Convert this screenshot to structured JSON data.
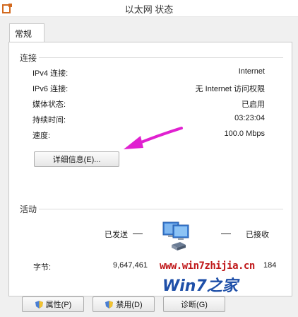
{
  "window": {
    "title": "以太网 状态"
  },
  "tabs": [
    {
      "label": "常规"
    }
  ],
  "connection": {
    "heading": "连接",
    "rows": [
      {
        "label": "IPv4 连接:",
        "value": "Internet"
      },
      {
        "label": "IPv6 连接:",
        "value": "无 Internet 访问权限"
      },
      {
        "label": "媒体状态:",
        "value": "已启用"
      },
      {
        "label": "持续时间:",
        "value": "03:23:04"
      },
      {
        "label": "速度:",
        "value": "100.0 Mbps"
      }
    ],
    "details_button": "详细信息(E)..."
  },
  "activity": {
    "heading": "活动",
    "sent_label": "已发送",
    "received_label": "已接收",
    "bytes_label": "字节:",
    "bytes_sent": "9,647,461",
    "bytes_received_visible": "184"
  },
  "watermark": {
    "url": "www.win7zhijia.cn",
    "logo": "Win7之家"
  },
  "buttons": {
    "properties": "属性(P)",
    "disable": "禁用(D)",
    "diagnose": "诊断(G)"
  },
  "colors": {
    "arrow": "#e020d0",
    "watermark_red": "#c0181a",
    "watermark_blue": "#1e4fa8"
  }
}
